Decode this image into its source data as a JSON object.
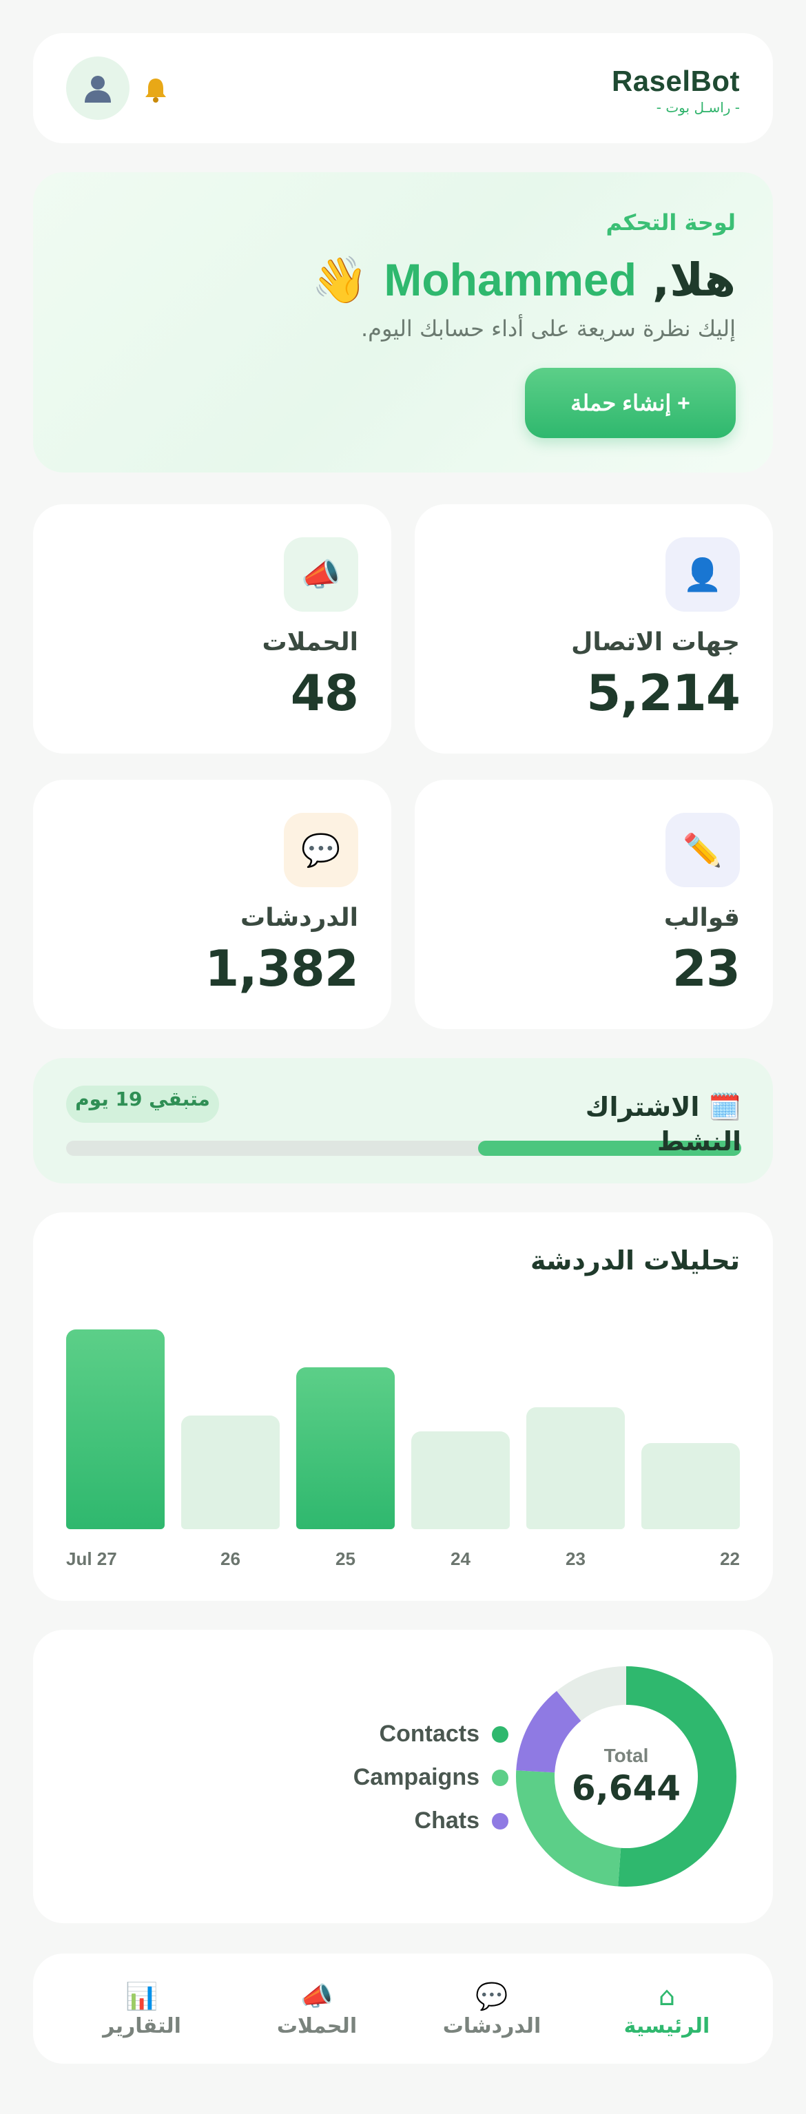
{
  "header": {
    "brand_title": "RaselBot",
    "brand_subtitle": "- راسـل بوت -",
    "avatar_icon": "user-icon",
    "notification_icon": "bell-icon"
  },
  "hero": {
    "label": "لوحة التحكم",
    "greeting_prefix": "هلا,",
    "user_name": "Mohammed",
    "wave_emoji": "👋",
    "subtitle": "إليك نظرة سريعة على أداء حسابك اليوم.",
    "cta_label": "+ إنشاء حملة"
  },
  "stats": {
    "contacts": {
      "label": "جهات الاتصال",
      "value": "5,214",
      "icon": "👤",
      "icon_bg": "#eef0fb"
    },
    "campaigns": {
      "label": "الحملات",
      "value": "48",
      "icon": "📣",
      "icon_bg": "#e8f6ec"
    },
    "templates": {
      "label": "قوالب",
      "value": "23",
      "icon": "✏️",
      "icon_bg": "#eef0fb"
    },
    "chats": {
      "label": "الدردشات",
      "value": "1,382",
      "icon": "💬",
      "icon_bg": "#fdf2e2"
    }
  },
  "subscription": {
    "icon": "🗓️",
    "title": "الاشتراك النشط",
    "remaining_label": "متبقي 19 يوم",
    "progress_fraction": 0.39
  },
  "analytics": {
    "title": "تحليلات الدردشة"
  },
  "chart_data": [
    {
      "type": "bar",
      "title": "تحليلات الدردشة",
      "categories": [
        "Jul 27",
        "26",
        "25",
        "24",
        "23",
        "22"
      ],
      "values": [
        100,
        57,
        81,
        49,
        61,
        43
      ],
      "highlight": [
        true,
        false,
        true,
        false,
        false,
        false
      ],
      "colors": {
        "highlight": "#2fb86e",
        "normal": "#dff2e4"
      },
      "grid": false
    },
    {
      "type": "pie",
      "center_label": "Total",
      "center_value": "6,644",
      "categories": [
        "Contacts",
        "Campaigns",
        "Chats"
      ],
      "values": [
        3400,
        1640,
        880
      ],
      "remainder": 724,
      "colors": [
        "#2fb86e",
        "#5ccf88",
        "#8f7ae3"
      ],
      "remainder_color": "#e6ede8",
      "legend": "left"
    }
  ],
  "bottom_nav": {
    "items": [
      {
        "label": "الرئيسية",
        "icon": "⌂",
        "active": true
      },
      {
        "label": "الدردشات",
        "icon": "💬",
        "active": false
      },
      {
        "label": "الحملات",
        "icon": "📣",
        "active": false
      },
      {
        "label": "التقارير",
        "icon": "📊",
        "active": false
      }
    ]
  }
}
